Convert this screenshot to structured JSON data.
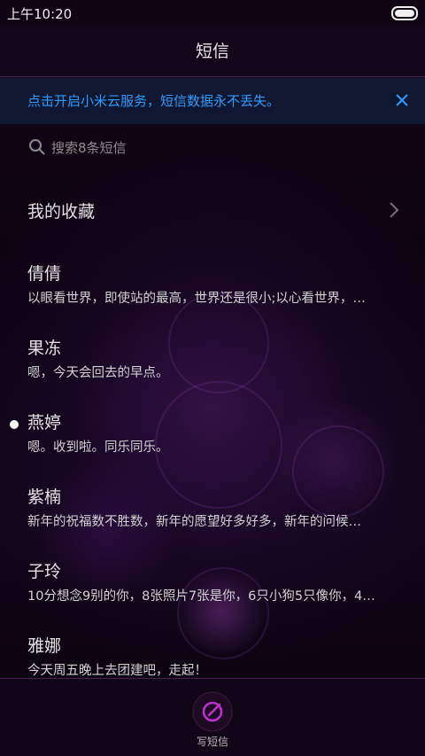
{
  "status_bar": {
    "time": "上午10:20",
    "battery_icon": "battery-icon"
  },
  "header": {
    "title": "短信"
  },
  "banner": {
    "text": "点击开启小米云服务，短信数据永不丢失。",
    "close_icon": "close-icon",
    "accent_color": "#2f9bff"
  },
  "search": {
    "placeholder": "搜索8条短信",
    "icon": "search-icon"
  },
  "favorites": {
    "label": "我的收藏",
    "icon": "chevron-right-icon"
  },
  "conversations": [
    {
      "name": "倩倩",
      "preview": "以眼看世界，即使站的最高，世界还是很小;以心看世界，…",
      "unread": false
    },
    {
      "name": "果冻",
      "preview": "嗯，今天会回去的早点。",
      "unread": false
    },
    {
      "name": "燕婷",
      "preview": "嗯。收到啦。同乐同乐。",
      "unread": true
    },
    {
      "name": "紫楠",
      "preview": "新年的祝福数不胜数，新年的愿望好多好多，新年的问候…",
      "unread": false
    },
    {
      "name": "子玲",
      "preview": "10分想念9别的你，8张照片7张是你，6只小狗5只像你，4…",
      "unread": false
    },
    {
      "name": "雅娜",
      "preview": "今天周五晚上去团建吧，走起！",
      "unread": false
    }
  ],
  "bottom_bar": {
    "compose_label": "写短信",
    "compose_icon": "compose-icon",
    "accent_color": "#c030d0"
  }
}
